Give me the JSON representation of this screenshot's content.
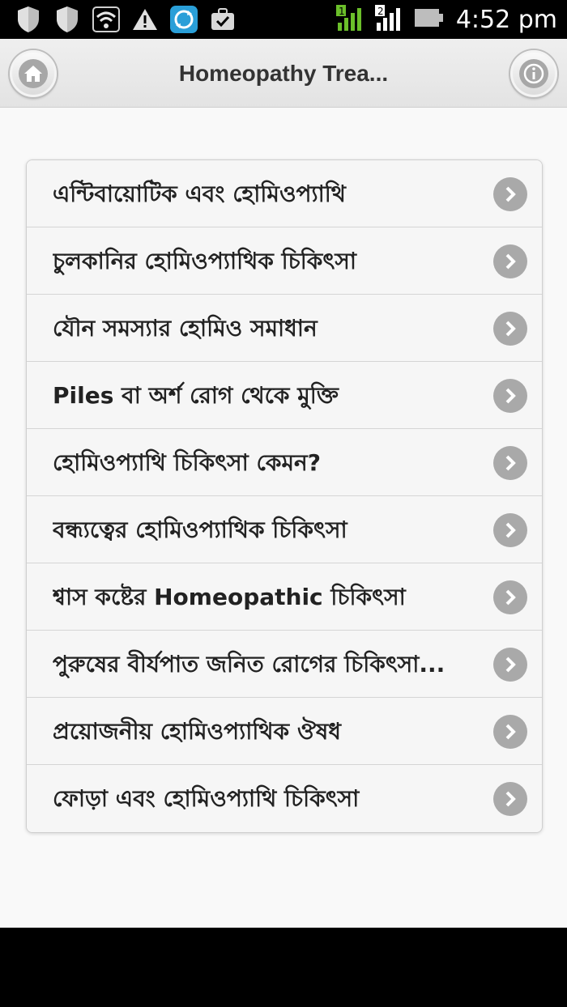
{
  "status_bar": {
    "time": "4:52 pm",
    "icons": [
      "shield-icon",
      "shield-icon",
      "wifi-icon",
      "warning-icon",
      "sync-app-icon",
      "briefcase-check-icon",
      "signal-sim1-icon",
      "signal-sim2-icon",
      "battery-icon"
    ],
    "sim1_label": "1",
    "sim2_label": "2"
  },
  "header": {
    "title": "Homeopathy Trea...",
    "home_icon": "home-icon",
    "info_icon": "info-icon"
  },
  "list": {
    "items": [
      {
        "label": "এন্টিবায়োটিক এবং হোমিওপ্যাথি"
      },
      {
        "label": "চুলকানির হোমিওপ্যাথিক চিকিৎসা"
      },
      {
        "label": "যৌন সমস্যার হোমিও সমাধান"
      },
      {
        "label": "Piles বা অর্শ রোগ থেকে মুক্তি"
      },
      {
        "label": "হোমিওপ্যাথি চিকিৎসা কেমন?"
      },
      {
        "label": "বন্ধ্যত্বের হোমিওপ্যাথিক চিকিৎসা"
      },
      {
        "label": "শ্বাস কষ্টের Homeopathic চিকিৎসা"
      },
      {
        "label": "পুরুষের বীর্যপাত জনিত রোগের চিকিৎসা..."
      },
      {
        "label": "প্রয়োজনীয় হোমিওপ্যাথিক ঔষধ"
      },
      {
        "label": "ফোড়া এবং হোমিওপ্যাথি চিকিৎসা"
      }
    ],
    "arrow_icon": "chevron-right-icon"
  },
  "colors": {
    "header_bg": "#e9e9e9",
    "list_bg": "#f6f6f6",
    "arrow_bg": "#a9a9a9",
    "text": "#222222"
  }
}
